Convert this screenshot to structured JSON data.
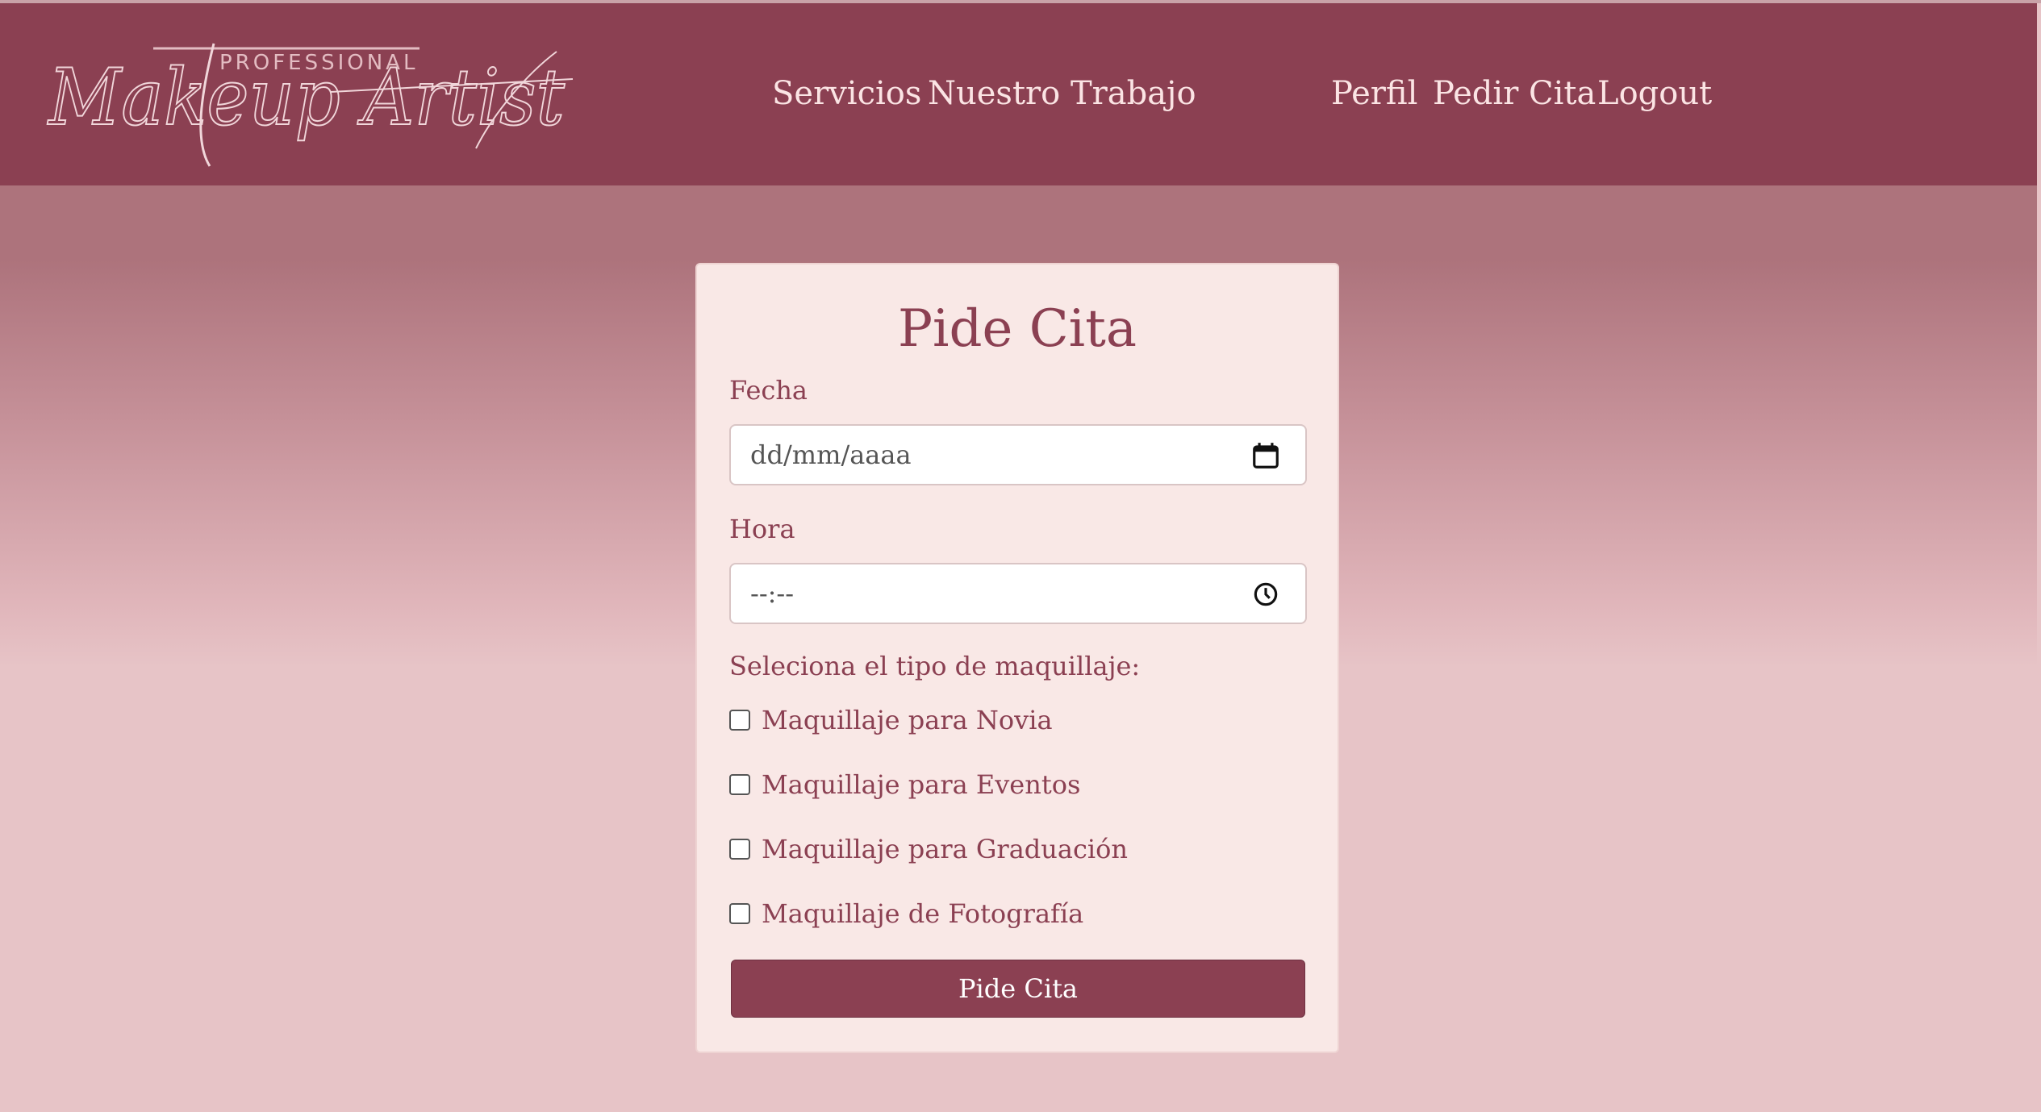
{
  "colors": {
    "brand": "#8b4052",
    "card_bg": "#f9e8e6",
    "nav_text": "#fbe4e4",
    "page_bg": "#e7c4c7"
  },
  "header": {
    "logo": {
      "top_text": "PROFESSIONAL",
      "script_text": "Makeup Artist",
      "icon": "makeup-artist-logo"
    },
    "nav": {
      "servicios": "Servicios",
      "nuestro_trabajo": "Nuestro Trabajo",
      "perfil": "Perfil",
      "pedir_cita": "Pedir Cita",
      "logout": "Logout"
    }
  },
  "form": {
    "title": "Pide Cita",
    "fecha": {
      "label": "Fecha",
      "placeholder": "dd/mm/aaaa",
      "icon": "calendar-icon"
    },
    "hora": {
      "label": "Hora",
      "placeholder": "--:--",
      "icon": "clock-icon"
    },
    "tipo_label": "Seleciona el tipo de maquillaje:",
    "options": [
      {
        "label": "Maquillaje para Novia",
        "checked": false
      },
      {
        "label": "Maquillaje para Eventos",
        "checked": false
      },
      {
        "label": "Maquillaje para Graduación",
        "checked": false
      },
      {
        "label": "Maquillaje de Fotografía",
        "checked": false
      }
    ],
    "submit_label": "Pide Cita"
  }
}
